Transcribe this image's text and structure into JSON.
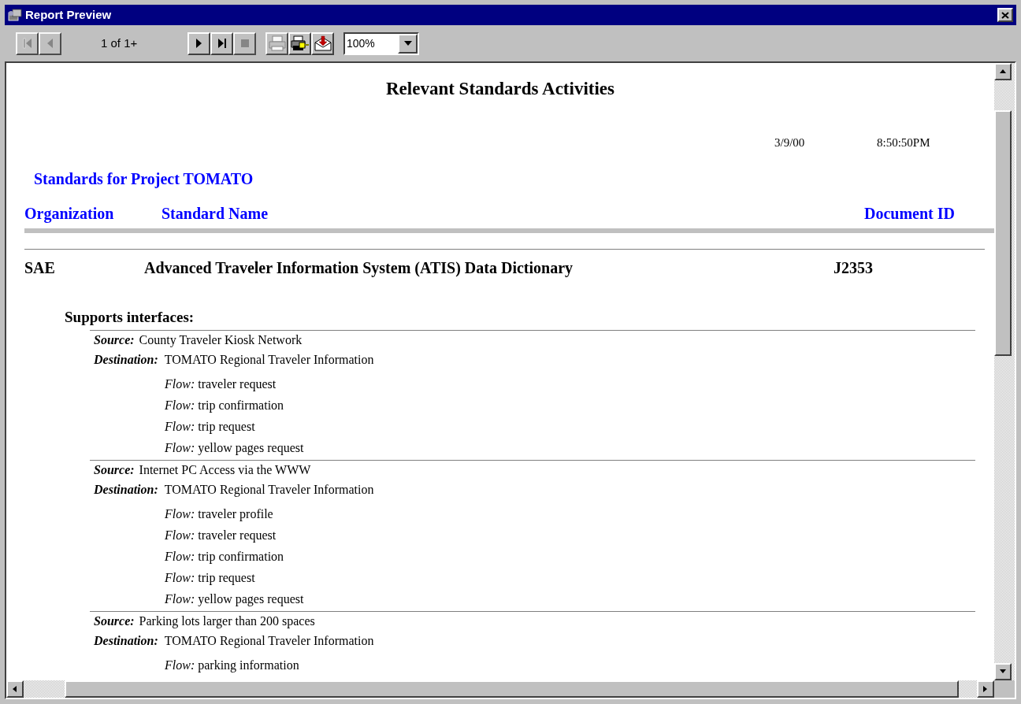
{
  "window": {
    "title": "Report Preview"
  },
  "toolbar": {
    "buttons": [
      {
        "kind": "first",
        "disabled": true
      },
      {
        "kind": "prev",
        "disabled": true
      }
    ],
    "page_indicator": "1 of 1+",
    "nav_buttons": [
      {
        "kind": "next",
        "disabled": false
      },
      {
        "kind": "last",
        "disabled": false
      },
      {
        "kind": "stop",
        "disabled": true
      }
    ],
    "action_buttons": [
      {
        "kind": "print",
        "disabled": true
      },
      {
        "kind": "print-setup",
        "disabled": false
      },
      {
        "kind": "export",
        "disabled": false
      }
    ],
    "zoom": {
      "value": "100%"
    }
  },
  "report": {
    "title": "Relevant Standards Activities",
    "date": "3/9/00",
    "time": "8:50:50PM",
    "group_heading": "Standards for Project TOMATO",
    "columns": [
      "Organization",
      "Standard Name",
      "Document ID"
    ],
    "standards": [
      {
        "organization": "SAE",
        "name": "Advanced Traveler Information System (ATIS) Data Dictionary",
        "document_id": "J2353",
        "interfaces_heading": "Supports interfaces:",
        "interfaces": [
          {
            "source_label": "Source:",
            "source": "County Traveler Kiosk Network",
            "destination_label": "Destination:",
            "destination": "TOMATO Regional Traveler Information",
            "flows": [
              {
                "label": "Flow:",
                "value": "traveler request"
              },
              {
                "label": "Flow:",
                "value": "trip confirmation"
              },
              {
                "label": "Flow:",
                "value": "trip request"
              },
              {
                "label": "Flow:",
                "value": "yellow pages request"
              }
            ]
          },
          {
            "source_label": "Source:",
            "source": "Internet PC Access via the WWW",
            "destination_label": "Destination:",
            "destination": "TOMATO Regional Traveler Information",
            "flows": [
              {
                "label": "Flow:",
                "value": "traveler profile"
              },
              {
                "label": "Flow:",
                "value": "traveler request"
              },
              {
                "label": "Flow:",
                "value": "trip confirmation"
              },
              {
                "label": "Flow:",
                "value": "trip request"
              },
              {
                "label": "Flow:",
                "value": "yellow pages request"
              }
            ]
          },
          {
            "source_label": "Source:",
            "source": "Parking lots larger than 200 spaces",
            "destination_label": "Destination:",
            "destination": "TOMATO Regional Traveler Information",
            "flows": [
              {
                "label": "Flow:",
                "value": "parking information"
              }
            ]
          }
        ]
      }
    ]
  }
}
